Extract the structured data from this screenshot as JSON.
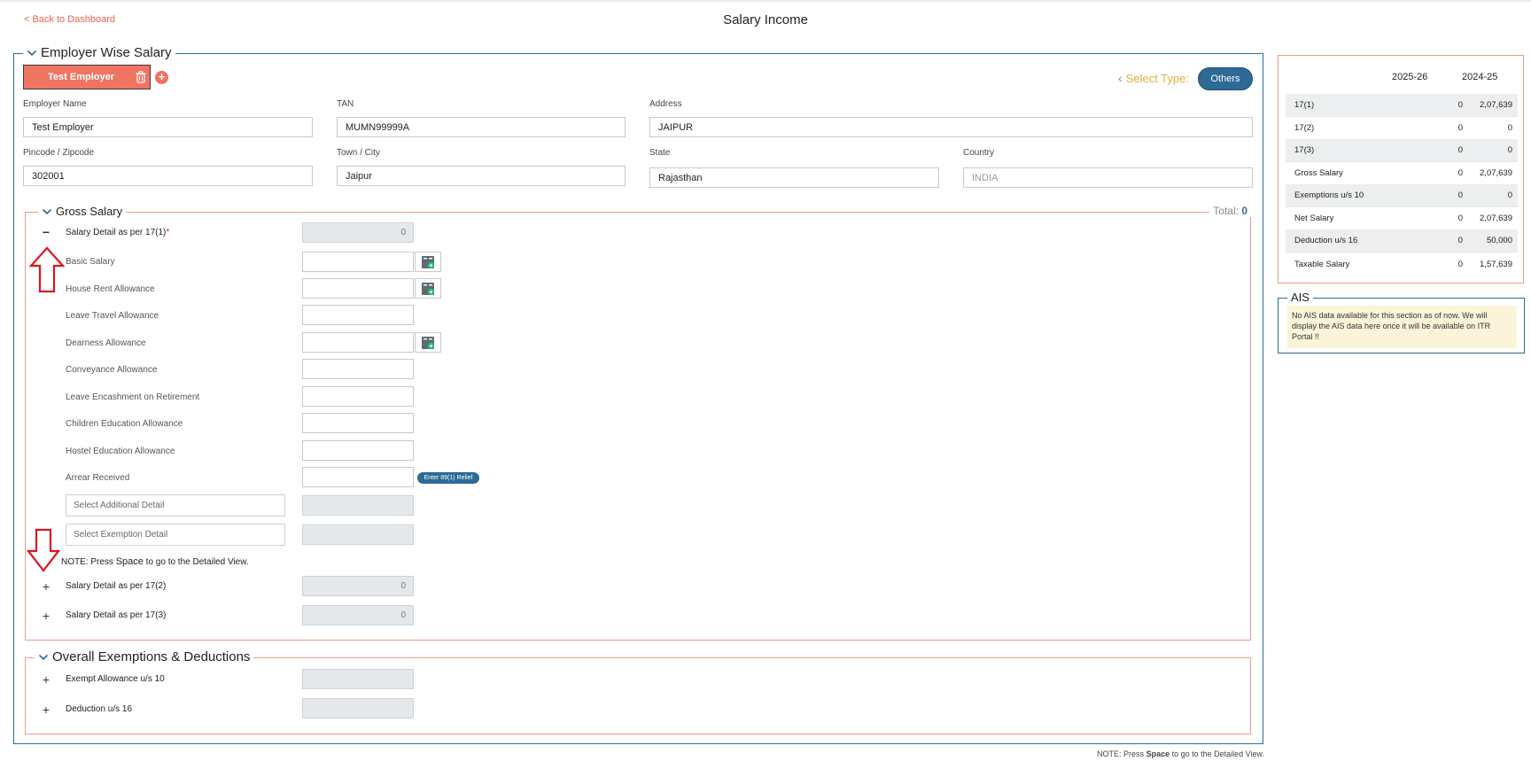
{
  "header": {
    "back_link": "< Back to Dashboard",
    "title": "Salary Income"
  },
  "employer_section": {
    "legend": "Employer Wise Salary",
    "tab_label": "Test Employer",
    "select_type_label": "Select Type:",
    "select_type_value": "Others",
    "fields": {
      "employer_name": {
        "label": "Employer Name",
        "value": "Test Employer"
      },
      "tan": {
        "label": "TAN",
        "value": "MUMN99999A"
      },
      "address": {
        "label": "Address",
        "value": "JAIPUR"
      },
      "pincode": {
        "label": "Pincode / Zipcode",
        "value": "302001"
      },
      "city": {
        "label": "Town / City",
        "value": "Jaipur"
      },
      "state": {
        "label": "State",
        "value": "Rajasthan"
      },
      "country": {
        "label": "Country",
        "value": "INDIA"
      }
    }
  },
  "gross_salary": {
    "legend": "Gross Salary",
    "total_label": "Total:",
    "total_value": "0",
    "detail_171": {
      "label": "Salary Detail as per 17(1)",
      "required_mark": "*",
      "value": "0"
    },
    "components": [
      "Basic Salary",
      "House Rent Allowance",
      "Leave Travel Allowance",
      "Dearness Allowance",
      "Conveyance Allowance",
      "Leave Encashment on Retirement",
      "Children Education Allowance",
      "Hostel Education Allowance",
      "Arrear Received"
    ],
    "relief_button": "Enter 89(1) Relief",
    "additional_placeholder": "Select Additional Detail",
    "exemption_placeholder": "Select Exemption Detail",
    "note_prefix": "NOTE: Press ",
    "note_key": "Space",
    "note_suffix": " to go to the Detailed View.",
    "detail_172": {
      "label": "Salary Detail as per 17(2)",
      "value": "0"
    },
    "detail_173": {
      "label": "Salary Detail as per 17(3)",
      "value": "0"
    }
  },
  "overall": {
    "legend": "Overall Exemptions & Deductions",
    "exempt_label": "Exempt Allowance u/s 10",
    "deduction_label": "Deduction u/s 16"
  },
  "summary": {
    "col1": "2025-26",
    "col2": "2024-25",
    "rows": [
      {
        "name": "17(1)",
        "v1": "0",
        "v2": "2,07,639"
      },
      {
        "name": "17(2)",
        "v1": "0",
        "v2": "0"
      },
      {
        "name": "17(3)",
        "v1": "0",
        "v2": "0"
      },
      {
        "name": "Gross Salary",
        "v1": "0",
        "v2": "2,07,639"
      },
      {
        "name": "Exemptions u/s 10",
        "v1": "0",
        "v2": "0"
      },
      {
        "name": "Net Salary",
        "v1": "0",
        "v2": "2,07,639"
      },
      {
        "name": "Deduction u/s 16",
        "v1": "0",
        "v2": "50,000"
      },
      {
        "name": "Taxable Salary",
        "v1": "0",
        "v2": "1,57,639"
      }
    ]
  },
  "ais": {
    "legend": "AIS",
    "message": "No AIS data available for this section as of now. We will display the AIS data here once it will be available on ITR Portal !!"
  },
  "footer": {
    "prefix": "NOTE: Press ",
    "key": "Space",
    "suffix": " to go to the Detailed View."
  },
  "colors": {
    "accent": "#f07462",
    "primary": "#2d6a96",
    "border_main": "#2a6b98",
    "border_sub": "#f09989",
    "annotation": "#e0141e"
  }
}
